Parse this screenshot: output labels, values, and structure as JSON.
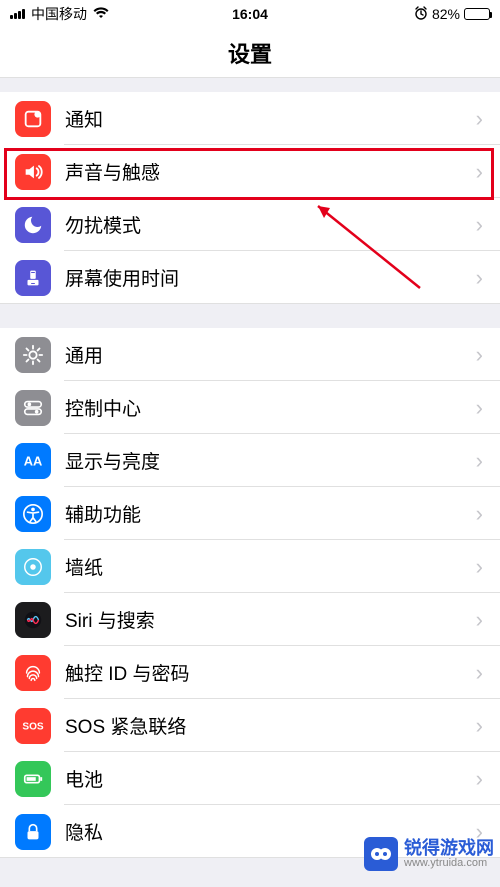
{
  "statusbar": {
    "carrier": "中国移动",
    "time": "16:04",
    "battery_pct": "82%"
  },
  "nav": {
    "title": "设置"
  },
  "group1": {
    "items": [
      {
        "label": "通知",
        "icon": "notifications-icon",
        "color": "#ff3b30"
      },
      {
        "label": "声音与触感",
        "icon": "sound-icon",
        "color": "#ff3b30",
        "highlight": true
      },
      {
        "label": "勿扰模式",
        "icon": "dnd-icon",
        "color": "#5856d6"
      },
      {
        "label": "屏幕使用时间",
        "icon": "screentime-icon",
        "color": "#5856d6"
      }
    ]
  },
  "group2": {
    "items": [
      {
        "label": "通用",
        "icon": "general-icon",
        "color": "#8e8e93"
      },
      {
        "label": "控制中心",
        "icon": "controlcenter-icon",
        "color": "#8e8e93"
      },
      {
        "label": "显示与亮度",
        "icon": "display-icon",
        "color": "#007aff"
      },
      {
        "label": "辅助功能",
        "icon": "accessibility-icon",
        "color": "#007aff"
      },
      {
        "label": "墙纸",
        "icon": "wallpaper-icon",
        "color": "#54c7ec"
      },
      {
        "label": "Siri 与搜索",
        "icon": "siri-icon",
        "color": "#1c1c1e"
      },
      {
        "label": "触控 ID 与密码",
        "icon": "touchid-icon",
        "color": "#ff3b30"
      },
      {
        "label": "SOS 紧急联络",
        "icon": "sos-icon",
        "color": "#ff3b30"
      },
      {
        "label": "电池",
        "icon": "battery-icon",
        "color": "#34c759"
      },
      {
        "label": "隐私",
        "icon": "privacy-icon",
        "color": "#007aff"
      }
    ]
  },
  "watermark": {
    "line1": "锐得游戏网",
    "line2": "www.ytruida.com"
  }
}
